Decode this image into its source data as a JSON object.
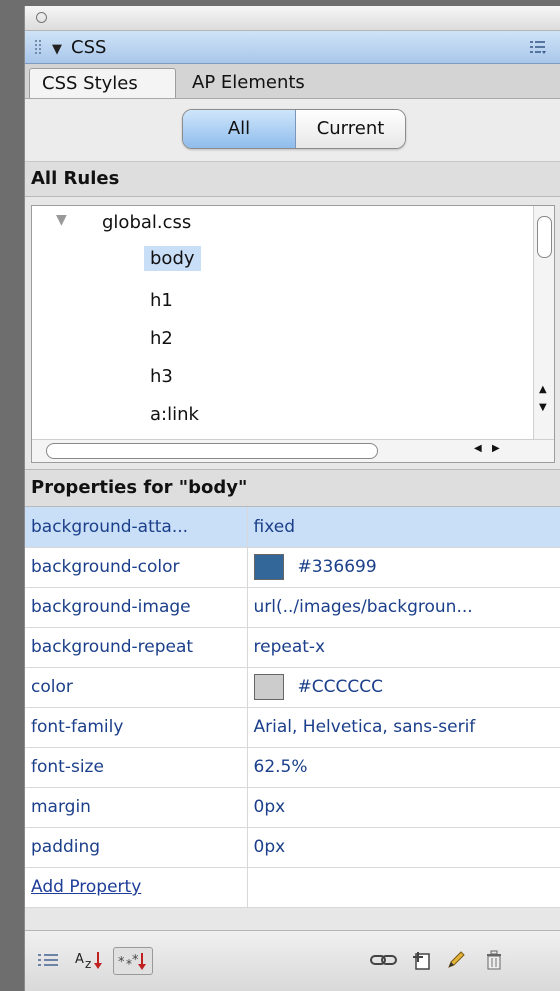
{
  "panel": {
    "title": "CSS",
    "tabs": [
      "CSS Styles",
      "AP Elements"
    ],
    "mode_toggle": {
      "options": [
        "All",
        "Current"
      ],
      "selected": "All"
    }
  },
  "all_rules": {
    "title": "All Rules",
    "stylesheet": "global.css",
    "rules": [
      "body",
      "h1",
      "h2",
      "h3",
      "a:link"
    ],
    "selected_rule": "body"
  },
  "properties": {
    "title": "Properties for \"body\"",
    "rows": [
      {
        "name": "background-atta...",
        "value": "fixed"
      },
      {
        "name": "background-color",
        "value": "#336699",
        "swatch": "#336699"
      },
      {
        "name": "background-image",
        "value": "url(../images/backgroun..."
      },
      {
        "name": "background-repeat",
        "value": "repeat-x"
      },
      {
        "name": "color",
        "value": "#CCCCCC",
        "swatch": "#CCCCCC"
      },
      {
        "name": "font-family",
        "value": "Arial, Helvetica, sans-serif"
      },
      {
        "name": "font-size",
        "value": "62.5%"
      },
      {
        "name": "margin",
        "value": "0px"
      },
      {
        "name": "padding",
        "value": "0px"
      }
    ],
    "add_property_label": "Add Property"
  },
  "bottom_toolbar": {
    "icons": [
      "category-view-icon",
      "alphabetical-view-icon",
      "set-properties-view-icon",
      "attach-stylesheet-icon",
      "new-css-rule-icon",
      "edit-rule-icon",
      "delete-rule-icon"
    ]
  }
}
